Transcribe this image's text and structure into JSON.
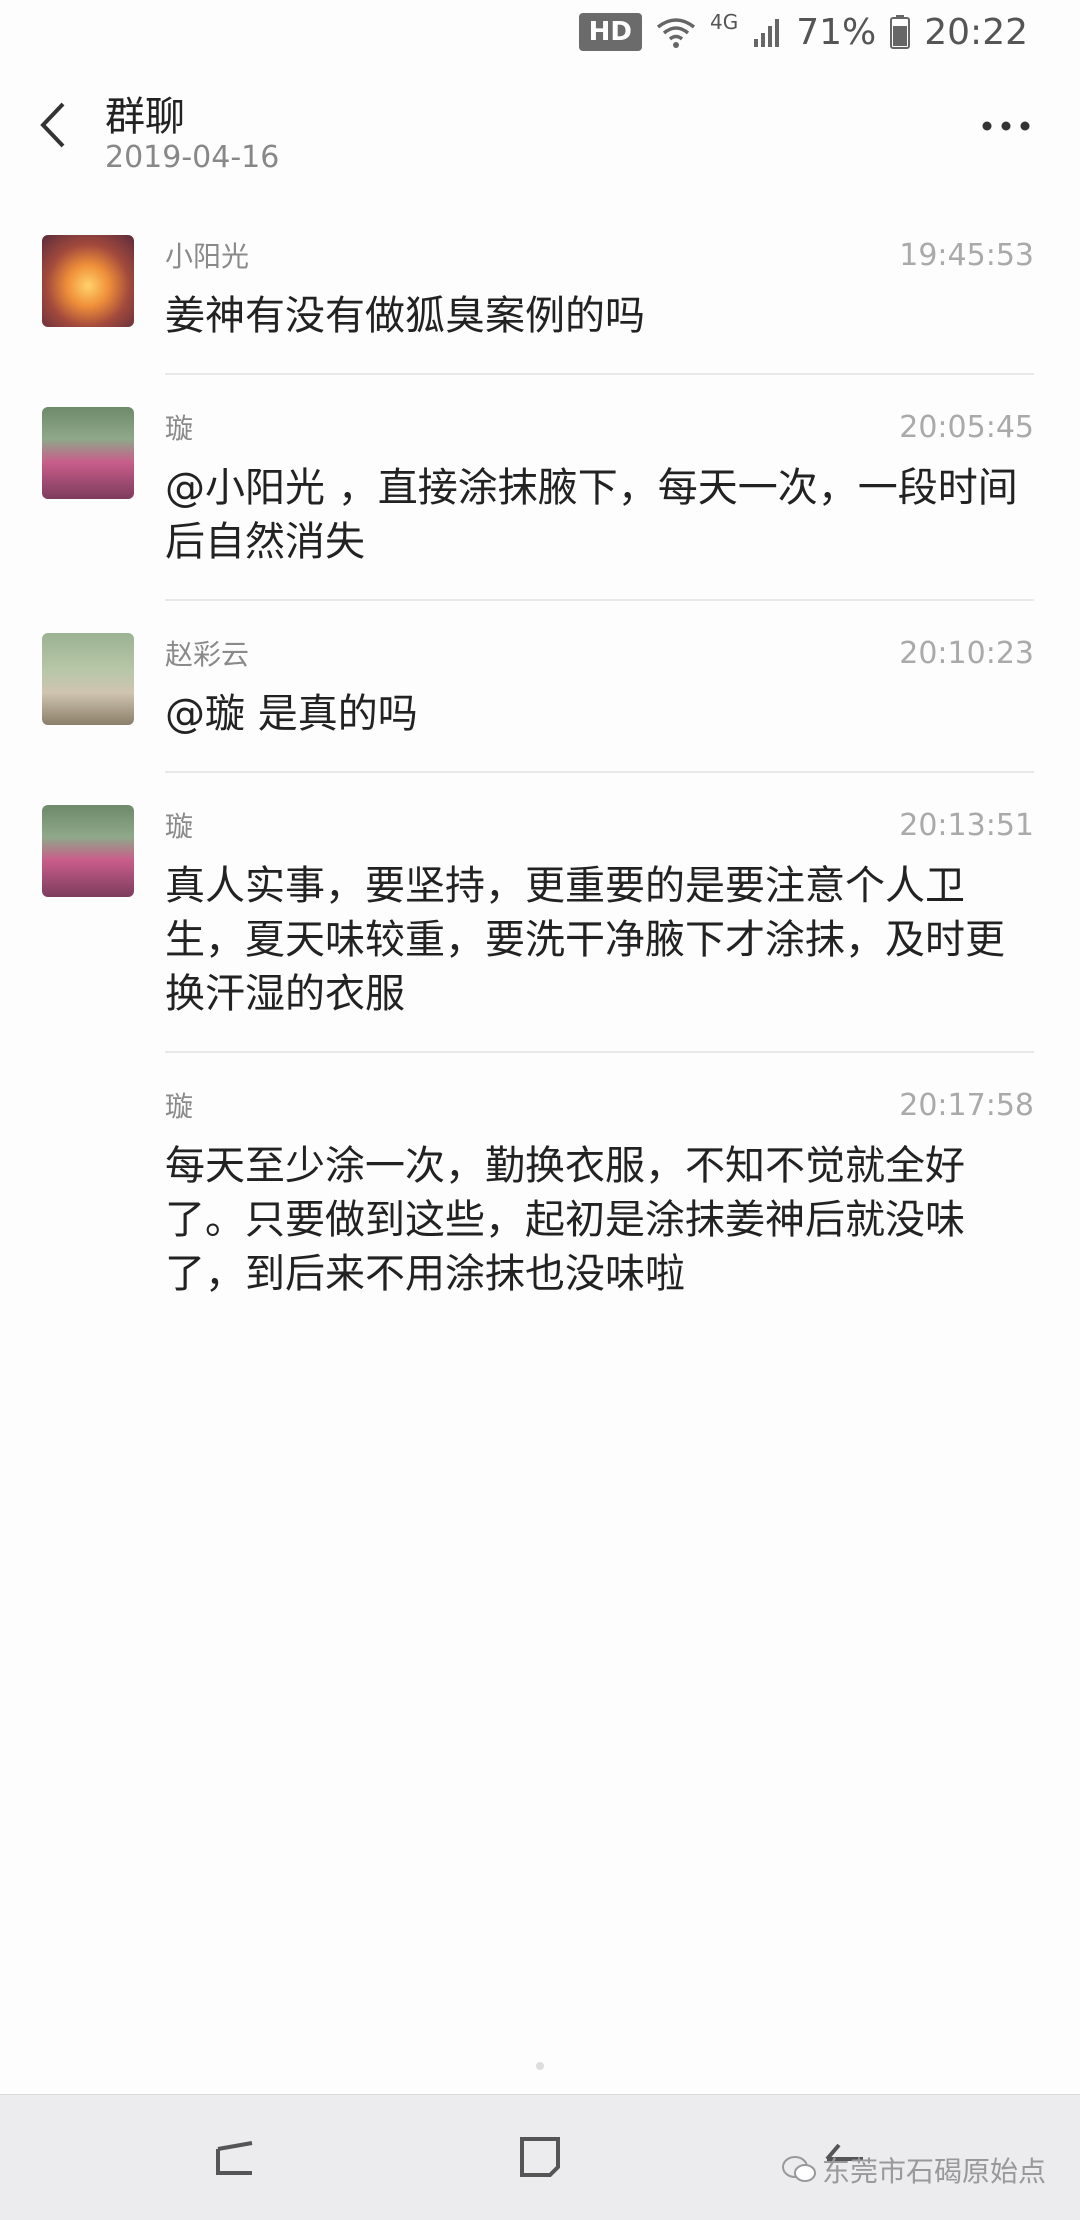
{
  "status_bar": {
    "hd": "HD",
    "network": "4G",
    "battery_percent": "71%",
    "time": "20:22"
  },
  "header": {
    "title": "群聊",
    "date": "2019-04-16"
  },
  "messages": [
    {
      "sender": "小阳光",
      "time": "19:45:53",
      "text": "姜神有没有做狐臭案例的吗",
      "avatar": "sunset-avatar"
    },
    {
      "sender": "璇",
      "time": "20:05:45",
      "text": "@小阳光 ，直接涂抹腋下，每天一次，一段时间后自然消失",
      "avatar": "person-avatar"
    },
    {
      "sender": "赵彩云",
      "time": "20:10:23",
      "text": "@璇 是真的吗",
      "avatar": "person-avatar-2"
    },
    {
      "sender": "璇",
      "time": "20:13:51",
      "text": "真人实事，要坚持，更重要的是要注意个人卫生，夏天味较重，要洗干净腋下才涂抹，及时更换汗湿的衣服",
      "avatar": "person-avatar"
    },
    {
      "sender": "璇",
      "time": "20:17:58",
      "text": "每天至少涂一次，勤换衣服，不知不觉就全好了。只要做到这些，起初是涂抹姜神后就没味了，到后来不用涂抹也没味啦",
      "avatar": ""
    }
  ],
  "watermark": "东莞市石碣原始点",
  "icons": {
    "back": "back-arrow-icon",
    "more": "more-dots-icon",
    "wifi": "wifi-icon",
    "signal": "signal-icon",
    "battery": "battery-icon"
  }
}
